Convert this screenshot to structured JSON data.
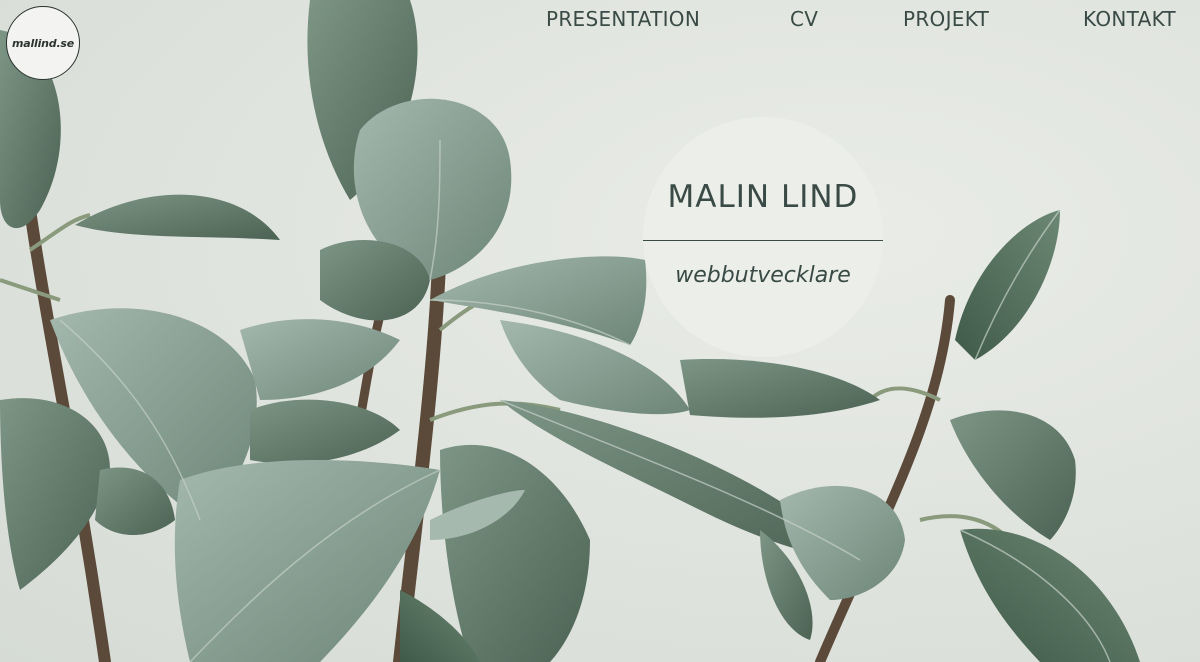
{
  "header": {
    "logo_text": "mallind.se"
  },
  "nav": {
    "items": [
      {
        "label": "PRESENTATION"
      },
      {
        "label": "CV"
      },
      {
        "label": "PROJEKT"
      },
      {
        "label": "KONTAKT"
      }
    ]
  },
  "hero": {
    "name": "MALIN LIND",
    "role": "webbutvecklare"
  },
  "colors": {
    "background": "#dfe3de",
    "text": "#3a4a46",
    "leaf_dark": "#5d7566",
    "leaf_light": "#93aaa0"
  }
}
